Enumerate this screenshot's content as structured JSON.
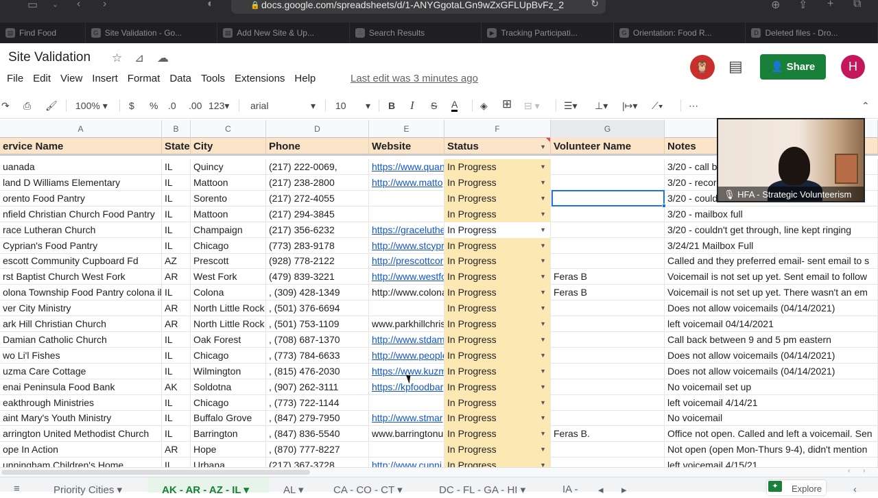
{
  "browser": {
    "url": "docs.google.com/spreadsheets/d/1-ANYGgotaLGn9wZxGFLUpBvFz_2",
    "tabs": [
      {
        "label": "Find Food",
        "icon": "page-icon"
      },
      {
        "label": "Site Validation - Go...",
        "icon": "g-icon"
      },
      {
        "label": "Add New Site & Up...",
        "icon": "page-icon"
      },
      {
        "label": "Search Results",
        "icon": "dots-icon"
      },
      {
        "label": "Tracking Participati...",
        "icon": "video-icon"
      },
      {
        "label": "Orientation: Food R...",
        "icon": "g-icon"
      },
      {
        "label": "Deleted files - Dro...",
        "icon": "d-icon"
      }
    ]
  },
  "doc": {
    "title": "Site Validation",
    "menu": [
      "File",
      "Edit",
      "View",
      "Insert",
      "Format",
      "Data",
      "Tools",
      "Extensions",
      "Help"
    ],
    "last_edit": "Last edit was 3 minutes ago",
    "share_label": "Share",
    "user_initial": "H"
  },
  "toolbar": {
    "zoom": "100%",
    "currency": "$",
    "percent": "%",
    "dec_less": ".0",
    "dec_more": ".00",
    "number_format": "123",
    "font": "arial",
    "font_size": "10",
    "bold": "B",
    "italic": "I",
    "strike": "S",
    "text_color": "A",
    "more": "⋯"
  },
  "columns": [
    "A",
    "B",
    "C",
    "D",
    "E",
    "F",
    "G"
  ],
  "headers": {
    "service_name": "ervice Name",
    "state": "State",
    "city": "City",
    "phone": "Phone",
    "website": "Website",
    "status": "Status",
    "volunteer": "Volunteer Name",
    "notes": "Notes"
  },
  "rows": [
    {
      "name": "uanada",
      "state": "IL",
      "city": "Quincy",
      "phone": "(217) 222-0069,",
      "website": "https://www.quan",
      "link": true,
      "status": "In Progress",
      "volunteer": "",
      "notes": "3/20 - call b"
    },
    {
      "name": "land D Williams Elementary",
      "state": "IL",
      "city": "Mattoon",
      "phone": "(217) 238-2800",
      "website": "http://www.matto",
      "link": true,
      "status": "In Progress",
      "volunteer": "",
      "notes": "3/20 - recor"
    },
    {
      "name": "orento Food Pantry",
      "state": "IL",
      "city": "Sorento",
      "phone": "(217) 272-4055",
      "website": "",
      "link": false,
      "status": "In Progress",
      "volunteer": "",
      "notes": "3/20 - could"
    },
    {
      "name": "nfield Christian Church Food Pantry",
      "state": "IL",
      "city": "Mattoon",
      "phone": "(217) 294-3845",
      "website": "",
      "link": false,
      "status": "In Progress",
      "volunteer": "",
      "notes": "3/20 - mailbox full"
    },
    {
      "name": "race Lutheran Church",
      "state": "IL",
      "city": "Champaign",
      "phone": "(217) 356-6232",
      "website": "https://graceluthe",
      "link": true,
      "status": "In Progress",
      "volunteer": "",
      "notes": "3/20 - couldn't get through, line kept ringing"
    },
    {
      "name": " Cyprian's Food Pantry",
      "state": "IL",
      "city": "Chicago",
      "phone": "(773) 283-9178",
      "website": "http://www.stcypr",
      "link": true,
      "status": "In Progress",
      "volunteer": "",
      "notes": "3/24/21 Mailbox Full"
    },
    {
      "name": "escott Community Cupboard Fd",
      "state": "AZ",
      "city": "Prescott",
      "phone": "(928) 778-2122",
      "website": "http://prescottcor",
      "link": true,
      "status": "In Progress",
      "volunteer": "",
      "notes": "Called and they preferred email- sent email to s"
    },
    {
      "name": "rst Baptist Church West Fork",
      "state": "AR",
      "city": "West Fork",
      "phone": "(479) 839-3221",
      "website": "http://www.westfo",
      "link": true,
      "status": "In Progress",
      "volunteer": "Feras B",
      "notes": "Voicemail is not set up yet. Sent email to follow"
    },
    {
      "name": "olona Township Food Pantry colona il",
      "state": "IL",
      "city": "Colona",
      "phone": ", (309) 428-1349",
      "website": "http://www.colona",
      "link": false,
      "status": "In Progress",
      "volunteer": "Feras B",
      "notes": "Voicemail is not set up yet. There wasn't an em"
    },
    {
      "name": "ver City Ministry",
      "state": "AR",
      "city": "North Little Rock",
      "phone": ", (501) 376-6694",
      "website": "",
      "link": false,
      "status": "In Progress",
      "volunteer": "",
      "notes": "Does not allow voicemails (04/14/2021)"
    },
    {
      "name": "ark Hill Christian Church",
      "state": "AR",
      "city": "North Little Rock",
      "phone": ", (501) 753-1109",
      "website": "www.parkhillchris",
      "link": false,
      "status": "In Progress",
      "volunteer": "",
      "notes": "left voicemail 04/14/2021"
    },
    {
      "name": " Damian Catholic Church",
      "state": "IL",
      "city": "Oak Forest",
      "phone": ", (708) 687-1370",
      "website": "http://www.stdam",
      "link": true,
      "status": "In Progress",
      "volunteer": "",
      "notes": "Call back between 9 and 5 pm eastern"
    },
    {
      "name": "wo Li'l Fishes",
      "state": "IL",
      "city": "Chicago",
      "phone": ", (773) 784-6633",
      "website": "http://www.people",
      "link": true,
      "status": "In Progress",
      "volunteer": "",
      "notes": "Does not allow voicemails (04/14/2021)"
    },
    {
      "name": "uzma Care Cottage",
      "state": "IL",
      "city": "Wilmington",
      "phone": ", (815) 476-2030",
      "website": "https://www.kuzm",
      "link": true,
      "status": "In Progress",
      "volunteer": "",
      "notes": " Does not allow voicemails (04/14/2021)"
    },
    {
      "name": "enai Peninsula Food Bank",
      "state": "AK",
      "city": "Soldotna",
      "phone": ", (907) 262-3111",
      "website": "https://kpfoodbar",
      "link": true,
      "status": "In Progress",
      "volunteer": "",
      "notes": "No voicemail set up"
    },
    {
      "name": "eakthrough Ministries",
      "state": "IL",
      "city": "Chicago",
      "phone": ", (773) 722-1144",
      "website": "",
      "link": false,
      "status": "In Progress",
      "volunteer": "",
      "notes": "left voicemail 4/14/21"
    },
    {
      "name": "aint Mary's Youth Ministry",
      "state": "IL",
      "city": "Buffalo Grove",
      "phone": ", (847) 279-7950",
      "website": "http://www.stmar",
      "link": true,
      "status": "In Progress",
      "volunteer": "",
      "notes": "No voicemail"
    },
    {
      "name": "arrington United Methodist Church",
      "state": "IL",
      "city": "Barrington",
      "phone": ", (847) 836-5540",
      "website": "www.barringtonu",
      "link": false,
      "status": "In Progress",
      "volunteer": "Feras B.",
      "notes": "Office not open. Called and left a voicemail. Sen"
    },
    {
      "name": "ope In Action",
      "state": "AR",
      "city": "Hope",
      "phone": ", (870) 777-8227",
      "website": "",
      "link": false,
      "status": "In Progress",
      "volunteer": "",
      "notes": "Not open (open Mon-Thurs 9-4), didn't mention"
    },
    {
      "name": "unningham Children's Home",
      "state": "IL",
      "city": "Urbana",
      "phone": "(217) 367-3728",
      "website": "http://www.cunni",
      "link": true,
      "status": "In Progress",
      "volunteer": "",
      "notes": "left voicemail 4/15/21"
    }
  ],
  "video": {
    "label": "HFA - Strategic Volunteerism"
  },
  "sheet_tabs": [
    "Priority Cities",
    "AK - AR - AZ - IL",
    "AL",
    "CA - CO - CT",
    "DC - FL - GA - HI",
    "IA - "
  ],
  "explore_label": "Explore",
  "colors": {
    "share_green": "#188038",
    "status_fill": "#fce8b2",
    "header_fill": "#fbe4c8",
    "link_blue": "#1155cc"
  }
}
